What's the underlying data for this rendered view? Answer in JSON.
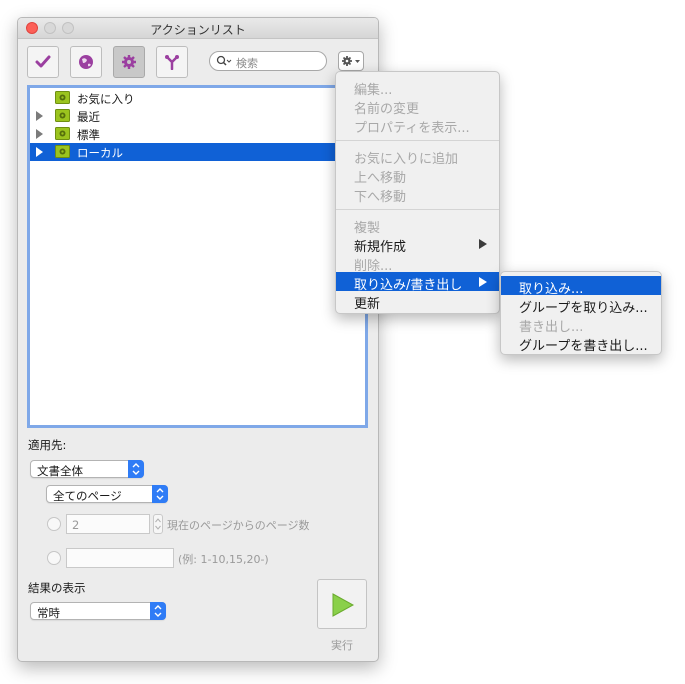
{
  "window": {
    "title": "アクションリスト"
  },
  "toolbar": {
    "buttons": [
      {
        "name": "checkmark-icon",
        "color": "#9b3fa0"
      },
      {
        "name": "globe-icon",
        "color": "#9b3fa0"
      },
      {
        "name": "gear-icon",
        "color": "#9b3fa0"
      },
      {
        "name": "branch-icon",
        "color": "#9b3fa0"
      }
    ],
    "search_placeholder": "検索"
  },
  "tree": {
    "items": [
      {
        "label": "お気に入り",
        "expandable": false,
        "selected": false
      },
      {
        "label": "最近",
        "expandable": true,
        "selected": false
      },
      {
        "label": "標準",
        "expandable": true,
        "selected": false
      },
      {
        "label": "ローカル",
        "expandable": true,
        "selected": true
      }
    ]
  },
  "apply": {
    "label": "適用先:",
    "scope_value": "文書全体",
    "pages_value": "全てのページ",
    "count_value": "2",
    "count_suffix": "現在のページからのページ数",
    "range_hint": "(例: 1-10,15,20-)"
  },
  "results": {
    "label": "結果の表示",
    "value": "常時"
  },
  "run": {
    "label": "実行"
  },
  "context_menu": {
    "items": [
      {
        "label": "編集...",
        "disabled": true
      },
      {
        "label": "名前の変更",
        "disabled": true
      },
      {
        "label": "プロパティを表示...",
        "disabled": true
      },
      {
        "label": "お気に入りに追加",
        "disabled": true
      },
      {
        "label": "上へ移動",
        "disabled": true
      },
      {
        "label": "下へ移動",
        "disabled": true
      },
      {
        "label": "複製",
        "disabled": true
      },
      {
        "label": "新規作成",
        "disabled": false,
        "submenu": true
      },
      {
        "label": "削除...",
        "disabled": true
      },
      {
        "label": "取り込み/書き出し",
        "disabled": false,
        "submenu": true,
        "highlighted": true
      },
      {
        "label": "更新",
        "disabled": false
      }
    ]
  },
  "submenu": {
    "items": [
      {
        "label": "取り込み...",
        "disabled": false,
        "highlighted": true
      },
      {
        "label": "グループを取り込み...",
        "disabled": false
      },
      {
        "label": "書き出し...",
        "disabled": true
      },
      {
        "label": "グループを書き出し...",
        "disabled": false
      }
    ]
  },
  "colors": {
    "accent": "#1061d6",
    "folder": "#9bc41e",
    "play": "#8ad04a"
  }
}
